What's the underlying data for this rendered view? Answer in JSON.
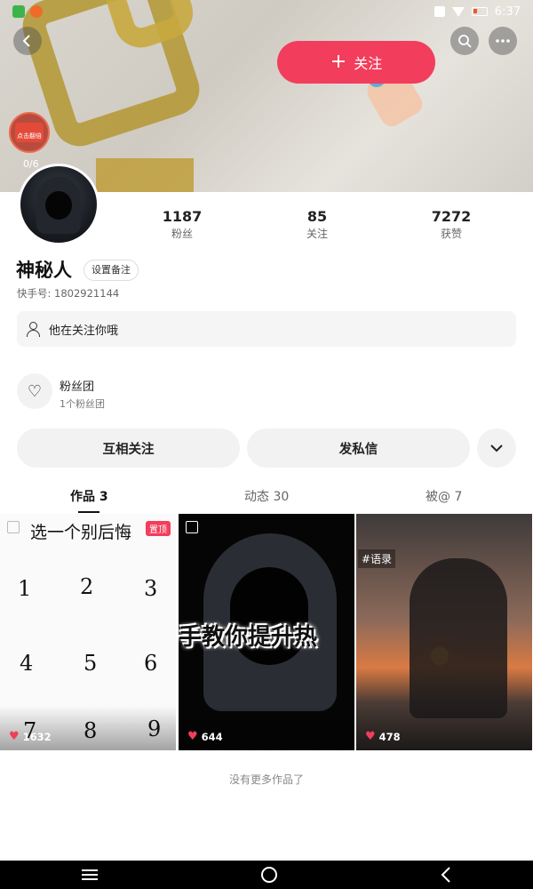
{
  "status_bar": {
    "time": "6:37"
  },
  "header": {
    "follow_label": "关注",
    "badge_count": "0/6",
    "badge_text": "点击翻倍"
  },
  "profile": {
    "name": "神秘人",
    "remark_label": "设置备注",
    "kuaishou_id": "快手号: 1802921144",
    "follow_tip": "他在关注你哦",
    "fan_club_title": "粉丝团",
    "fan_club_sub": "1个粉丝团"
  },
  "stats": [
    {
      "value": "1187",
      "label": "粉丝"
    },
    {
      "value": "85",
      "label": "关注"
    },
    {
      "value": "7272",
      "label": "获赞"
    }
  ],
  "actions": {
    "mutual_follow": "互相关注",
    "private_message": "发私信"
  },
  "tabs": [
    {
      "label": "作品 3",
      "active": true
    },
    {
      "label": "动态 30",
      "active": false
    },
    {
      "label": "被@ 7",
      "active": false
    }
  ],
  "works": [
    {
      "title": "选一个别后悔",
      "pinned_label": "置顶",
      "likes": "1632",
      "numbers": [
        "1",
        "2",
        "3",
        "4",
        "5",
        "6",
        "7",
        "8",
        "9"
      ]
    },
    {
      "caption": "手教你提升热",
      "likes": "644"
    },
    {
      "tag": "#语录",
      "likes": "478"
    }
  ],
  "footer": {
    "no_more": "没有更多作品了"
  },
  "colors": {
    "accent": "#f23d5c",
    "bg": "#ffffff",
    "chip_bg": "#f2f2f2"
  },
  "icons": {
    "back": "back-arrow-icon",
    "search": "search-icon",
    "more": "more-dots-icon",
    "person": "person-icon",
    "fan": "heart-outline-icon",
    "chevron": "chevron-down-icon",
    "image": "image-icon",
    "heart": "heart-icon",
    "nav_menu": "menu-icon",
    "nav_home": "home-circle-icon",
    "nav_back": "nav-back-icon"
  }
}
